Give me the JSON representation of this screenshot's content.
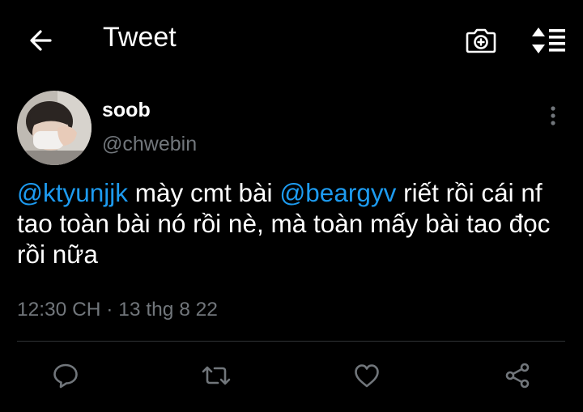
{
  "header": {
    "title": "Tweet",
    "back_icon": "arrow-left-icon",
    "camera_icon": "camera-plus-icon",
    "sort_icon": "sort-list-icon"
  },
  "author": {
    "name": "soob",
    "handle": "@chwebin",
    "avatar_icon": "avatar-photo"
  },
  "tweet": {
    "mention1": "@ktyunjjk",
    "text1": " mày cmt bài ",
    "mention2": "@beargyv",
    "text2": " riết rồi cái nf tao toàn bài nó rồi nè, mà toàn mấy bài tao đọc rồi nữa",
    "timestamp": "12:30 CH · 13 thg 8 22"
  },
  "actions": {
    "reply_icon": "reply-icon",
    "retweet_icon": "retweet-icon",
    "like_icon": "heart-icon",
    "share_icon": "share-icon"
  },
  "colors": {
    "background": "#000000",
    "text": "#ffffff",
    "muted": "#71767b",
    "link": "#1d9bf0"
  }
}
